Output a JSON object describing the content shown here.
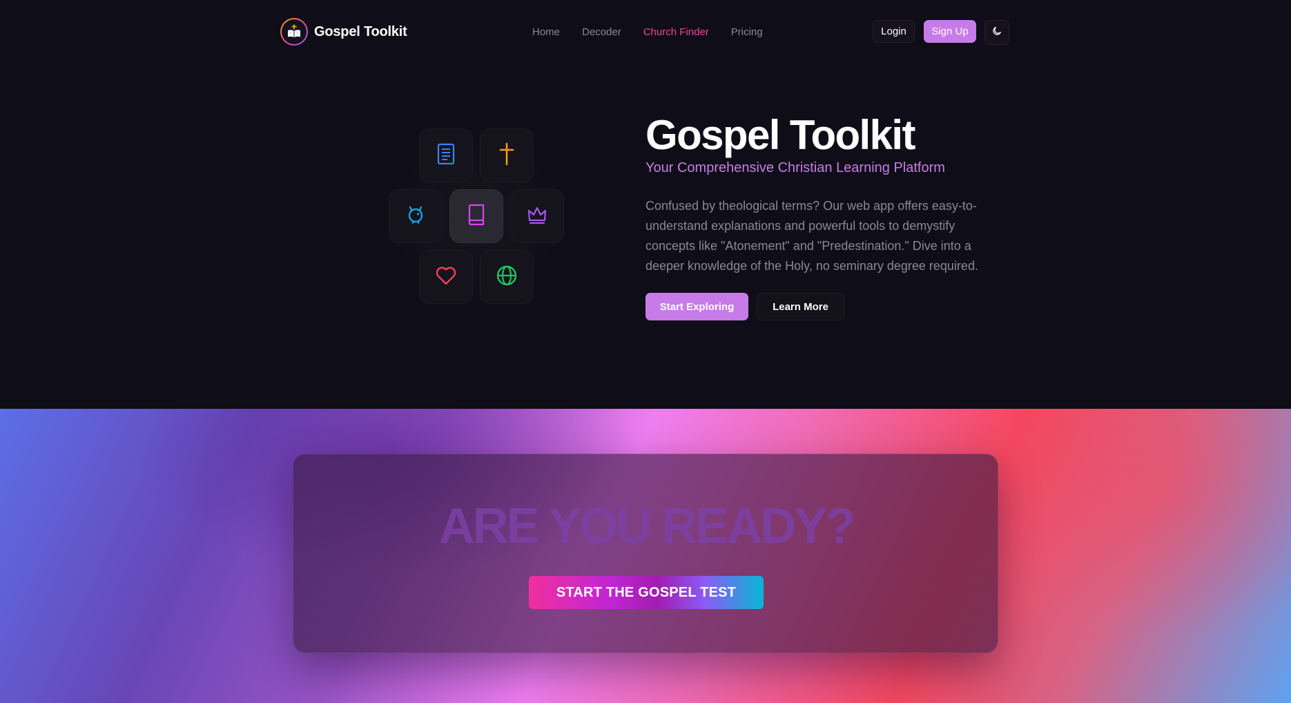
{
  "brand": {
    "name": "Gospel Toolkit",
    "logo_icon": "open-bible-with-cross-icon"
  },
  "nav": {
    "links": [
      {
        "label": "Home",
        "active": false
      },
      {
        "label": "Decoder",
        "active": false
      },
      {
        "label": "Church Finder",
        "active": true
      },
      {
        "label": "Pricing",
        "active": false
      }
    ],
    "login_label": "Login",
    "signup_label": "Sign Up",
    "theme_toggle_icon": "moon-icon"
  },
  "hero": {
    "title": "Gospel Toolkit",
    "subtitle": "Your Comprehensive Christian Learning Platform",
    "description": "Confused by theological terms? Our web app offers easy-to-understand explanations and powerful tools to demystify concepts like \"Atonement\" and \"Predestination.\" Dive into a deeper knowledge of the Holy, no seminary degree required.",
    "primary_cta": "Start Exploring",
    "secondary_cta": "Learn More",
    "icon_tiles": [
      {
        "icon": "document-icon",
        "color": "#3b82f6"
      },
      {
        "icon": "cross-icon",
        "color": "#f59e0b"
      },
      {
        "icon": "piggy-bank-icon",
        "color": "#0ea5e9"
      },
      {
        "icon": "book-icon",
        "color": "#d946ef"
      },
      {
        "icon": "crown-icon",
        "color": "#a855f7"
      },
      {
        "icon": "heart-icon",
        "color": "#f43f5e"
      },
      {
        "icon": "globe-icon",
        "color": "#22c55e"
      }
    ]
  },
  "promo": {
    "heading": "ARE YOU READY?",
    "cta": "START THE GOSPEL TEST"
  },
  "colors": {
    "accent": "#c77be8",
    "active_link": "#ec4899",
    "background": "#0f0d17"
  }
}
